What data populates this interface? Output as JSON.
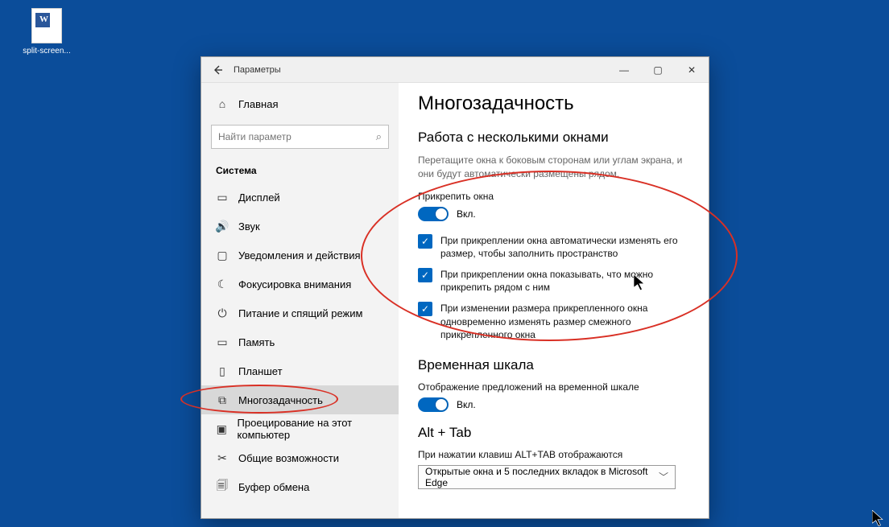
{
  "desktop": {
    "file_label": "split-screen..."
  },
  "window": {
    "title": "Параметры",
    "controls": {
      "min": "—",
      "max": "▢",
      "close": "✕"
    }
  },
  "sidebar": {
    "home": "Главная",
    "search_placeholder": "Найти параметр",
    "section": "Система",
    "items": [
      {
        "icon": "display-icon",
        "label": "Дисплей"
      },
      {
        "icon": "sound-icon",
        "label": "Звук"
      },
      {
        "icon": "notify-icon",
        "label": "Уведомления и действия"
      },
      {
        "icon": "focus-icon",
        "label": "Фокусировка внимания"
      },
      {
        "icon": "power-icon",
        "label": "Питание и спящий режим"
      },
      {
        "icon": "memory-icon",
        "label": "Память"
      },
      {
        "icon": "tablet-icon",
        "label": "Планшет"
      },
      {
        "icon": "multitask-icon",
        "label": "Многозадачность"
      },
      {
        "icon": "project-icon",
        "label": "Проецирование на этот компьютер"
      },
      {
        "icon": "shared-icon",
        "label": "Общие возможности"
      },
      {
        "icon": "clipboard-icon",
        "label": "Буфер обмена"
      }
    ],
    "active_index": 7
  },
  "content": {
    "page_title": "Многозадачность",
    "section1_title": "Работа с несколькими окнами",
    "section1_desc": "Перетащите окна к боковым сторонам или углам экрана, и они будут автоматически размещены рядом.",
    "snap_label": "Прикрепить окна",
    "snap_state": "Вкл.",
    "checkboxes": [
      "При прикреплении окна автоматически изменять его размер, чтобы заполнить пространство",
      "При прикреплении окна показывать, что можно прикрепить рядом с ним",
      "При изменении размера прикрепленного окна одновременно изменять размер смежного прикрепленного окна"
    ],
    "section2_title": "Временная шкала",
    "timeline_label": "Отображение предложений на временной шкале",
    "timeline_state": "Вкл.",
    "section3_title": "Alt + Tab",
    "alttab_label": "При нажатии клавиш ALT+TAB отображаются",
    "alttab_value": "Открытые окна и 5 последних вкладок в Microsoft Edge"
  }
}
